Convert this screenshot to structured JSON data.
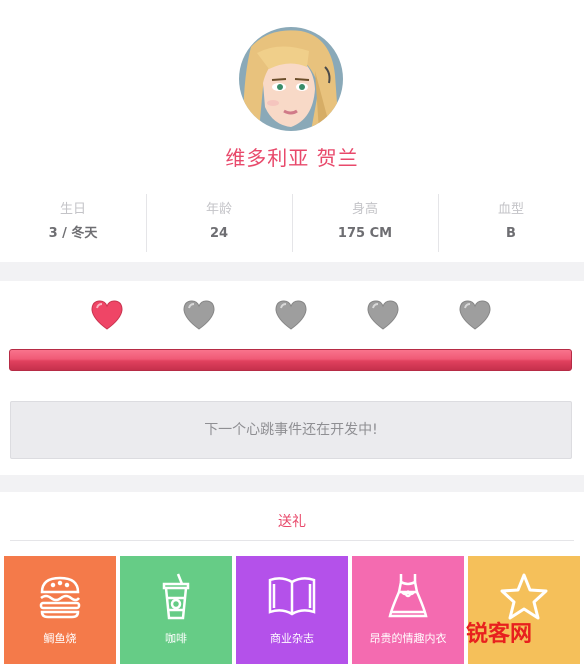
{
  "profile": {
    "name": "维多利亚 贺兰",
    "stats": [
      {
        "label": "生日",
        "value": "3 / 冬天"
      },
      {
        "label": "年龄",
        "value": "24"
      },
      {
        "label": "身高",
        "value": "175 CM"
      },
      {
        "label": "血型",
        "value": "B"
      }
    ]
  },
  "affection": {
    "hearts_filled": 1,
    "hearts_total": 5,
    "progress": 1.0,
    "notice": "下一个心跳事件还在开发中!",
    "colors": {
      "filled_heart": "#ef4566",
      "empty_heart": "#9e9e9e",
      "bar": "#f05a76"
    }
  },
  "gifts": {
    "title": "送礼",
    "items": [
      {
        "label": "鲷鱼烧",
        "icon": "burger-icon",
        "color": "#f47a4a"
      },
      {
        "label": "咖啡",
        "icon": "drink-cup-icon",
        "color": "#66cc86"
      },
      {
        "label": "商业杂志",
        "icon": "open-book-icon",
        "color": "#b451ea"
      },
      {
        "label": "昂贵的情趣内衣",
        "icon": "dress-icon",
        "color": "#f46bb0"
      },
      {
        "label": "",
        "icon": "star-icon",
        "color": "#f5c05a"
      }
    ]
  },
  "watermark": "锐客网"
}
